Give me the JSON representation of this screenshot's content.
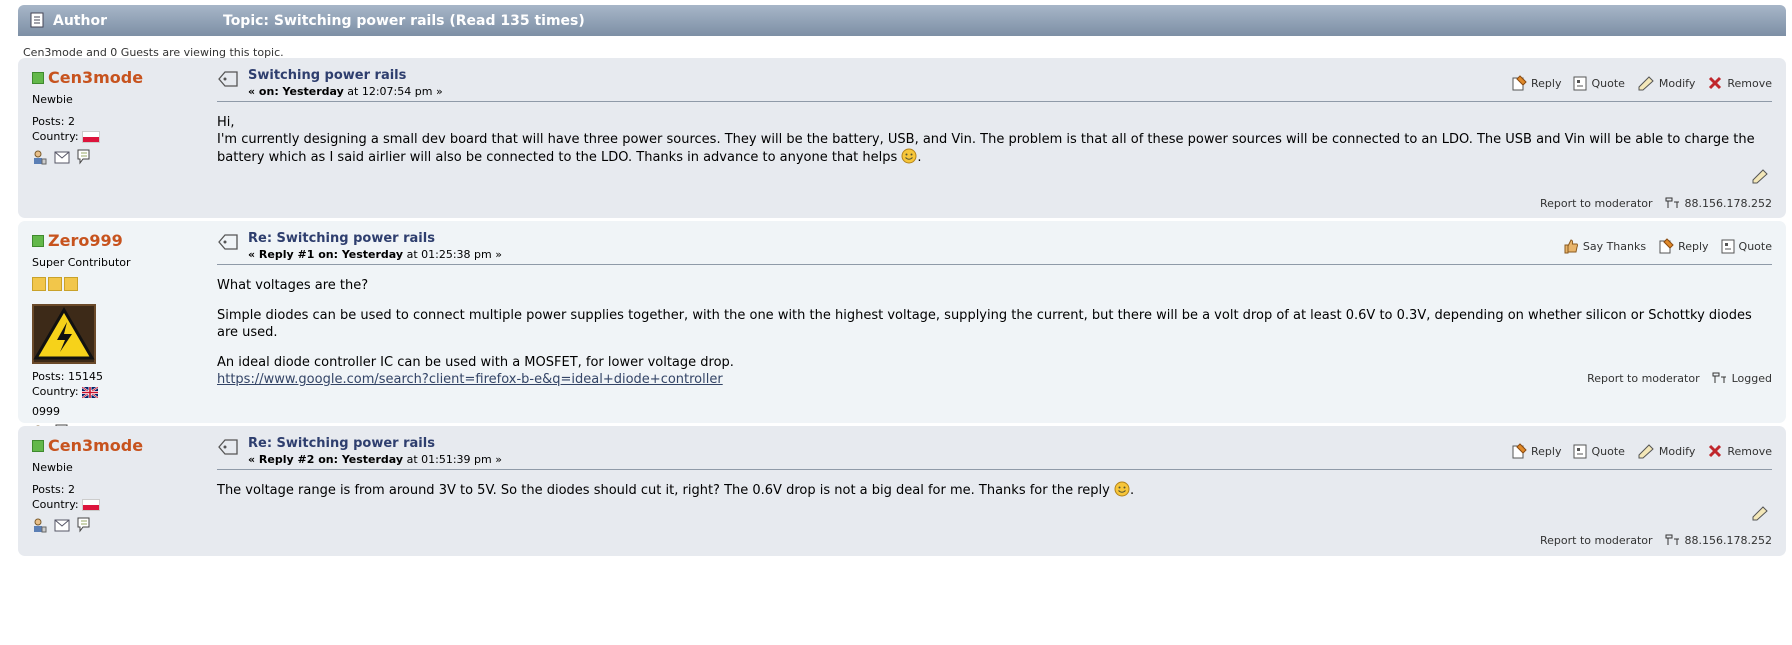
{
  "header": {
    "author_label": "Author",
    "topic_label": "Topic: Switching power rails  (Read 135 times)"
  },
  "viewing": "Cen3mode and 0 Guests are viewing this topic.",
  "labels": {
    "posts_prefix": "Posts: ",
    "country_label": "Country: ",
    "reply": "Reply",
    "quote": "Quote",
    "modify": "Modify",
    "remove": "Remove",
    "say_thanks": "Say Thanks",
    "report": "Report to moderator",
    "logged": "Logged"
  },
  "posts": [
    {
      "author": "Cen3mode",
      "rank": "Newbie",
      "posts": "Posts: 2",
      "country_flag": "poland-flag",
      "subject": "Switching power rails",
      "meta_on": "« on: Yesterday",
      "meta_time": " at 12:07:54 pm »",
      "body1": "Hi,",
      "body2": "I'm currently designing a small dev board that will have three power sources. They will be the battery, USB, and Vin. The problem is that all of these power sources will be connected to an LDO. The USB and Vin will be able to charge the battery which as I said airlier will also be connected to the LDO. Thanks in advance to anyone that helps ",
      "ip": "88.156.178.252"
    },
    {
      "author": "Zero999",
      "rank": "Super Contributor",
      "posts": "Posts: 15145",
      "country_flag": "uk-flag",
      "signature_text": "0999",
      "subject": "Re: Switching power rails",
      "meta_on": "« Reply #1 on: Yesterday",
      "meta_time": " at 01:25:38 pm »",
      "body1": "What voltages are the?",
      "body2": "Simple diodes can be used to connect multiple power supplies together, with the one with the highest voltage, supplying the current, but there will be a volt drop of at least 0.6V to 0.3V, depending on whether silicon or Schottky diodes are used.",
      "body3": "An ideal diode controller IC can be used with a MOSFET, for lower voltage drop.",
      "link": "https://www.google.com/search?client=firefox-b-e&q=ideal+diode+controller"
    },
    {
      "author": "Cen3mode",
      "rank": "Newbie",
      "posts": "Posts: 2",
      "country_flag": "poland-flag",
      "subject": "Re: Switching power rails",
      "meta_on": "« Reply #2 on: Yesterday",
      "meta_time": " at 01:51:39 pm »",
      "body1": "The voltage range is from around 3V to 5V. So the diodes should cut it, right? The 0.6V drop is not a big deal for me. Thanks for the reply ",
      "ip": "88.156.178.252"
    }
  ],
  "colors": {
    "header_bar": "#8a9bb0",
    "post_bg_alt": "#e7eaef",
    "post_bg": "#f0f4f7",
    "username": "#c7531e",
    "subject": "#2e3e6e",
    "online": "#63b84a"
  }
}
